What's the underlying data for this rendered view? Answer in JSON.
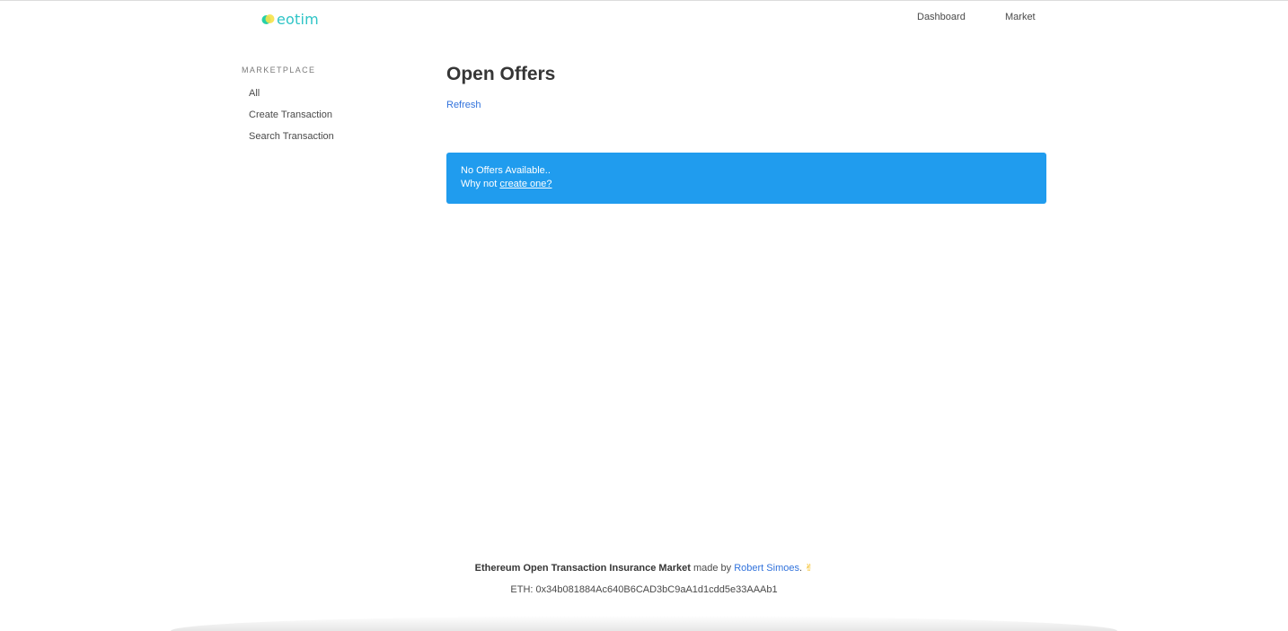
{
  "brand": {
    "name": "eotim"
  },
  "nav": {
    "dashboard": "Dashboard",
    "market": "Market"
  },
  "sidebar": {
    "section_label": "MARKETPLACE",
    "items": [
      "All",
      "Create Transaction",
      "Search Transaction"
    ]
  },
  "main": {
    "title": "Open Offers",
    "refresh_label": "Refresh",
    "notice": {
      "line1": "No Offers Available..",
      "line2_prefix": "Why not ",
      "line2_link": "create one?"
    }
  },
  "footer": {
    "app_name": "Ethereum Open Transaction Insurance Market",
    "made_by": " made by ",
    "author": "Robert Simoes",
    "suffix": ". ",
    "emoji": "✌",
    "eth_line": "ETH: 0x34b081884Ac640B6CAD3bC9aA1d1cdd5e33AAAb1"
  },
  "colors": {
    "accent": "#209cee",
    "link": "#3273dc",
    "brand": "#2ec4c6"
  }
}
